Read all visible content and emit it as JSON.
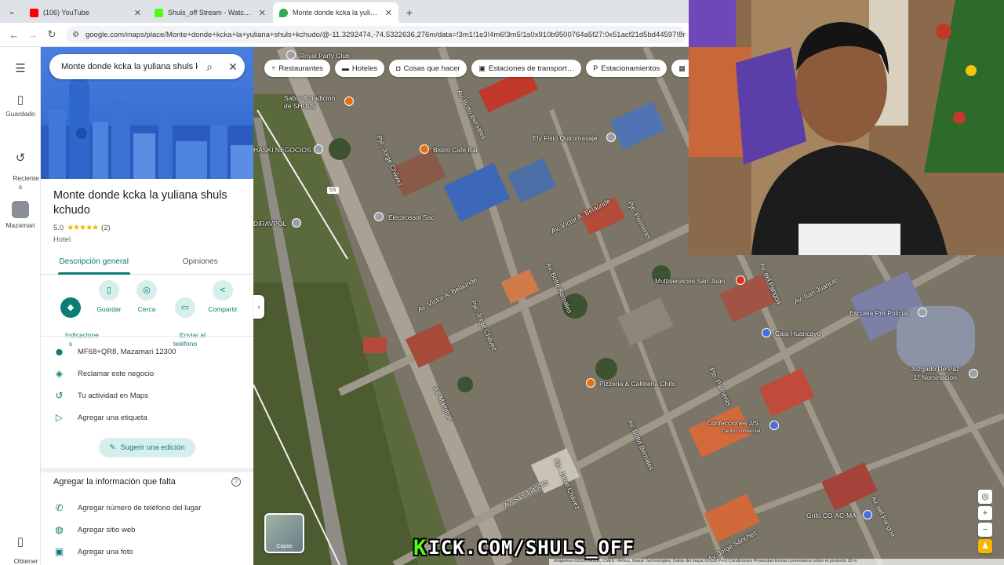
{
  "browser": {
    "tabs": [
      {
        "title": "(106) YouTube",
        "color": "#ff0000"
      },
      {
        "title": "Shuls_off Stream - Watch Live o",
        "color": "#53fc18"
      },
      {
        "title": "Monte donde kcka la yuliana sh",
        "color": "#34a853"
      }
    ],
    "url": "google.com/maps/place/Monte+donde+kcka+la+yuliana+shuls+kchudo/@-11.3292474,-74.5322636,276m/data=!3m1!1e3!4m6!3m5!1s0x910b9500764a5f27:0x51acf21d5bd44597!8m2!3d"
  },
  "rail": {
    "saved": "Guardado",
    "recent": "Reciente\ns",
    "mazamari": "Mazamari",
    "get_app": "Obtener\napp"
  },
  "search": {
    "query": "Monte donde kcka la yuliana shuls k"
  },
  "place": {
    "title": "Monte donde kcka la yuliana shuls kchudo",
    "rating": "5.0",
    "stars": "★★★★★",
    "reviews": "(2)",
    "category": "Hotel"
  },
  "panel_tabs": [
    "Descripción general",
    "Opiniones"
  ],
  "actions": [
    {
      "label": "Indicacione\ns",
      "icon": "◆"
    },
    {
      "label": "Guardar",
      "icon": "▯"
    },
    {
      "label": "Cerca",
      "icon": "◎"
    },
    {
      "label": "Enviar al\nteléfono",
      "icon": "▭"
    },
    {
      "label": "Compartir",
      "icon": "<"
    }
  ],
  "info": [
    {
      "text": "MF68+QR8, Mazamari 12300",
      "icon": "⬤"
    },
    {
      "text": "Reclamar este negocio",
      "icon": "◈"
    },
    {
      "text": "Tu actividad en Maps",
      "icon": "↺"
    },
    {
      "text": "Agregar una etiqueta",
      "icon": "▷"
    }
  ],
  "suggest_edit": "Sugerir una edición",
  "missing_info": {
    "title": "Agregar la información que falta",
    "items": [
      {
        "text": "Agregar número de teléfono del lugar",
        "icon": "✆"
      },
      {
        "text": "Agregar sitio web",
        "icon": "◍"
      },
      {
        "text": "Agregar una foto",
        "icon": "▣"
      }
    ]
  },
  "chips": [
    {
      "label": "Restaurantes",
      "icon": "🍴"
    },
    {
      "label": "Hoteles",
      "icon": "▬"
    },
    {
      "label": "Cosas que hacer",
      "icon": "◘"
    },
    {
      "label": "Estaciones de transport…",
      "icon": "▣"
    },
    {
      "label": "Estacionamientos",
      "icon": "P"
    },
    {
      "label": "",
      "icon": "▦"
    }
  ],
  "map_labels": {
    "royal": "Royal Party Club",
    "sabor": "Sabor & tradicion\nde SHULS",
    "bistro": "Bistro Café Bar",
    "fisio": "Ely Fisio Quiromasaje",
    "haski": "HASKI NEGOCIOS",
    "electro": "Electrossol Sac",
    "diravpol": "DIRAVPOL",
    "multi": "Multiservicios San Juan",
    "escuela": "Escuela Pre Policial",
    "caja": "Caja Huancayo",
    "juzgado": "Juzgado De Paz\n1° Nominacion",
    "pizzeria": "Pizzeria & Cafeteria Chito",
    "confecciones": "Confecciones J/S",
    "centro": "Centro comercial",
    "grifo": "Grifo CO-AC-MA",
    "route": "5S"
  },
  "streets": {
    "botto1": "Av. Botto Bernales",
    "chavez1": "Pje. Jorge Chávez",
    "belaunde1": "Av. Víctor A. Belaúnde",
    "palmeras1": "Pje. Palmeras",
    "belaunde2": "Av. Víctor A. Belaúnde",
    "botto2": "Av. Botto Bernales",
    "chavez2": "Pje. Jorge Chávez",
    "pangoa1": "Av. del Pangoa",
    "sanjuancito1": "Av. San Juancito",
    "marginal": "Av. Marginal",
    "palmeras2": "Pje. Palmeras",
    "sanjuancito2": "Av. San Juancito",
    "botto3": "Av. Botto Bernales",
    "chavez3": "Pje. Jorge Chávez",
    "pangoa2": "Av. del Pangoa",
    "sanchez": "Av. Jorge Sánchez",
    "malvinas": "Malvinas"
  },
  "layers": "Capas",
  "attribution": "Imágenes ©2026 Airbus, CNES / Airbus, Maxar Technologies, Datos del mapa ©2026   Perú   Condiciones   Privacidad   Enviar comentarios sobre el producto   20 m",
  "kick_text": "KICK.COM/SHULS_OFF",
  "kick_k": "K"
}
